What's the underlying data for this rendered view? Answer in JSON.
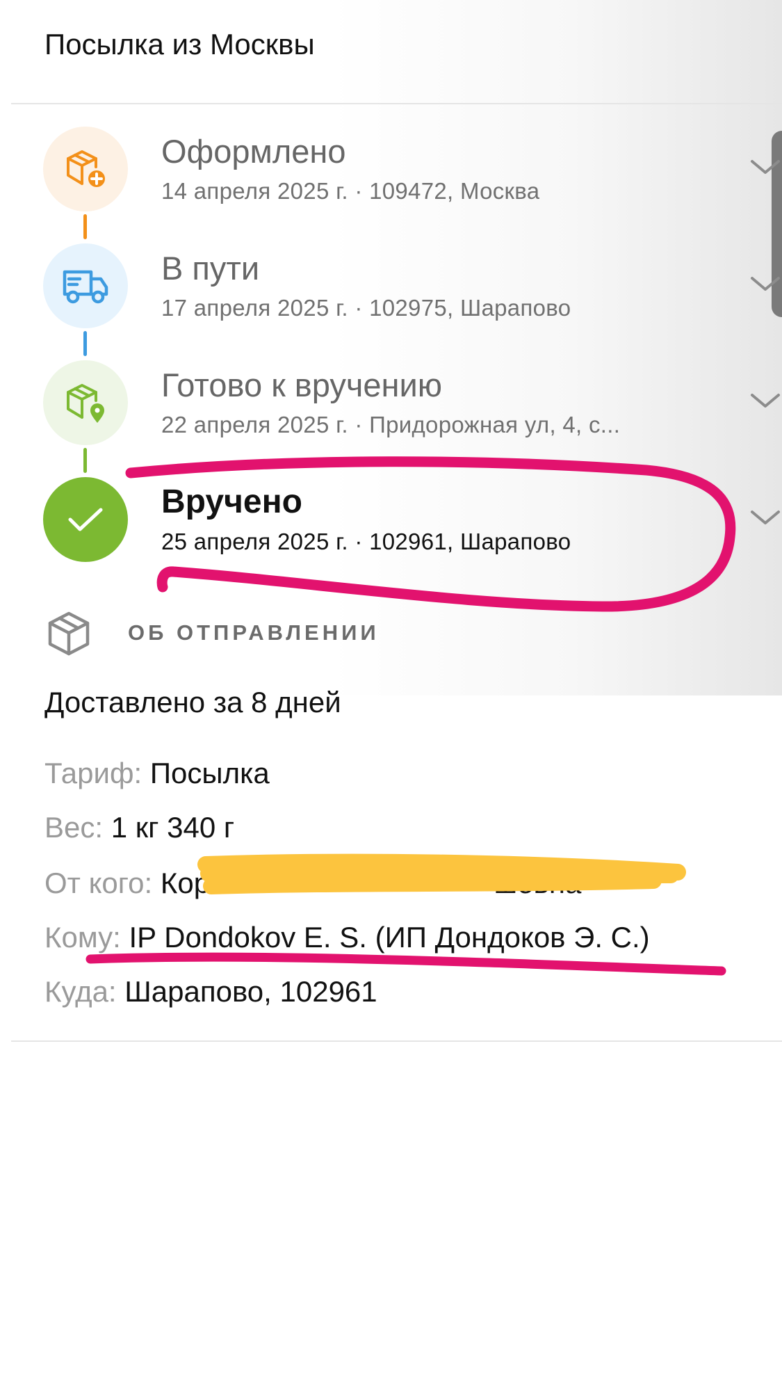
{
  "header": {
    "title": "Посылка из Москвы"
  },
  "timeline": [
    {
      "title": "Оформлено",
      "subtitle": "14 апреля 2025 г. · 109472, Москва",
      "icon": "package-add-icon",
      "icon_color": "#f39019",
      "icon_bg": "#fdf1e4",
      "connector_color": "#f39019",
      "active": false
    },
    {
      "title": "В пути",
      "subtitle": "17 апреля 2025 г. · 102975, Шарапово",
      "icon": "truck-icon",
      "icon_color": "#3d9be0",
      "icon_bg": "#e6f3fd",
      "connector_color": "#3d9be0",
      "active": false
    },
    {
      "title": "Готово к вручению",
      "subtitle": "22 апреля 2025 г. · Придорожная ул, 4, с...",
      "icon": "package-location-icon",
      "icon_color": "#7cb932",
      "icon_bg": "#eef6e6",
      "connector_color": "#7cb932",
      "active": false
    },
    {
      "title": "Вручено",
      "subtitle": "25 апреля 2025 г. · 102961, Шарапово",
      "icon": "checkmark-icon",
      "icon_color": "#ffffff",
      "icon_bg": "#7cb932",
      "active": true
    }
  ],
  "about": {
    "section_label": "ОБ ОТПРАВЛЕНИИ",
    "delivered": "Доставлено за 8 дней",
    "rows": [
      {
        "label": "Тариф:",
        "value": "Посылка"
      },
      {
        "label": "Вес:",
        "value": "1 кг 340 г"
      },
      {
        "label": "От кого:",
        "value": "Кор                                   шевна"
      },
      {
        "label": "Кому:",
        "value": "IP Dondokov E. S. (ИП Дондоков Э. С.)"
      },
      {
        "label": "Куда:",
        "value": "Шарапово, 102961"
      }
    ]
  },
  "colors": {
    "annotation_pink": "#e2126e",
    "redaction_yellow": "#fcc43e"
  }
}
